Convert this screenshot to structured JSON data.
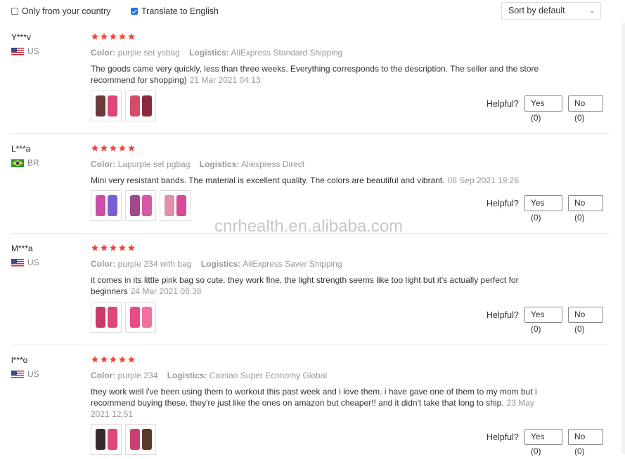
{
  "filters": {
    "only_country_label": "Only from your country",
    "only_country_checked": false,
    "translate_label": "Translate to English",
    "translate_checked": true,
    "sort_label": "Sort by default"
  },
  "labels": {
    "color": "Color:",
    "logistics": "Logistics:",
    "helpful": "Helpful?"
  },
  "reviews": [
    {
      "user": "Y***v",
      "country": "US",
      "rating": 5,
      "color": "purple set ysbag",
      "logistics": "AliExpress Standard Shipping",
      "text": "The goods came very quickly, less than three weeks. Everything corresponds to the description. The seller and the store recommend for shopping)",
      "date": "21 Mar 2021 04:13",
      "yes": "Yes (0)",
      "no": "No (0)"
    },
    {
      "user": "L***a",
      "country": "BR",
      "rating": 5,
      "color": "Lapurple set pgbag",
      "logistics": "Aliexpress Direct",
      "text": "Mini very resistant bands. The material is excellent quality. The colors are beautiful and vibrant.",
      "date": "08 Sep 2021 19:26",
      "yes": "Yes (0)",
      "no": "No (0)"
    },
    {
      "user": "M***a",
      "country": "US",
      "rating": 5,
      "color": "purple 234 with bag",
      "logistics": "AliExpress Saver Shipping",
      "text": "it comes in its little pink bag so cute. they work fine. the light strength seems like too light but it's actually perfect for beginners",
      "date": "24 Mar 2021 08:38",
      "yes": "Yes (0)",
      "no": "No (0)"
    },
    {
      "user": "l***o",
      "country": "US",
      "rating": 5,
      "color": "purple 234",
      "logistics": "Cainiao Super Economy Global",
      "text": "they work well i've been using them to workout this past week and i love them. i have gave one of them to my mom but i recommend buying these. they're just like the ones on amazon but cheaper!! and it didn't take that long to ship.",
      "date": "23 May 2021 12:51",
      "yes": "Yes (0)",
      "no": "No (0)"
    }
  ],
  "watermark": "cnrhealth.en.alibaba.com",
  "colors": {
    "star": "#f44336",
    "accent": "#1a73e8",
    "photo_pink": "#e0457b"
  }
}
